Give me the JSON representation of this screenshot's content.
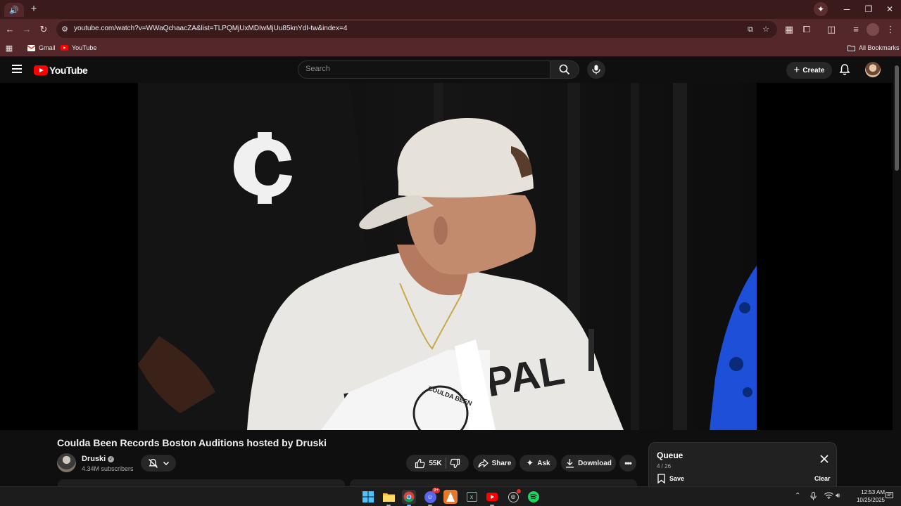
{
  "browser": {
    "tab_audio_icon": "🔊",
    "url": "youtube.com/watch?v=WWaQchaacZA&list=TLPQMjUxMDIwMjUu85knYdI-tw&index=4",
    "bookmarks": [
      {
        "label": "Gmail",
        "icon": "gmail-icon"
      },
      {
        "label": "YouTube",
        "icon": "youtube-icon"
      }
    ],
    "all_bookmarks_label": "All Bookmarks"
  },
  "youtube": {
    "logo_text": "YouTube",
    "search_placeholder": "Search",
    "create_label": "Create"
  },
  "video": {
    "title": "Coulda Been Records Boston Auditions hosted by Druski",
    "channel_name": "Druski",
    "subscribers": "4.34M subscribers",
    "likes": "55K",
    "share_label": "Share",
    "ask_label": "Ask",
    "download_label": "Download",
    "shirt_text": "MUNICIPAL",
    "paper_logo_text": "COULDA BEEN"
  },
  "queue": {
    "title": "Queue",
    "count": "4 / 26",
    "save_label": "Save",
    "clear_label": "Clear"
  },
  "taskbar": {
    "time": "12:53 AM",
    "date": "10/25/2025",
    "discord_badge": "9+"
  },
  "colors": {
    "youtube_red": "#ff0000",
    "chrome_frame": "#3b1a1c",
    "chrome_toolbar": "#54282b",
    "page_background": "#0f0f0f"
  }
}
